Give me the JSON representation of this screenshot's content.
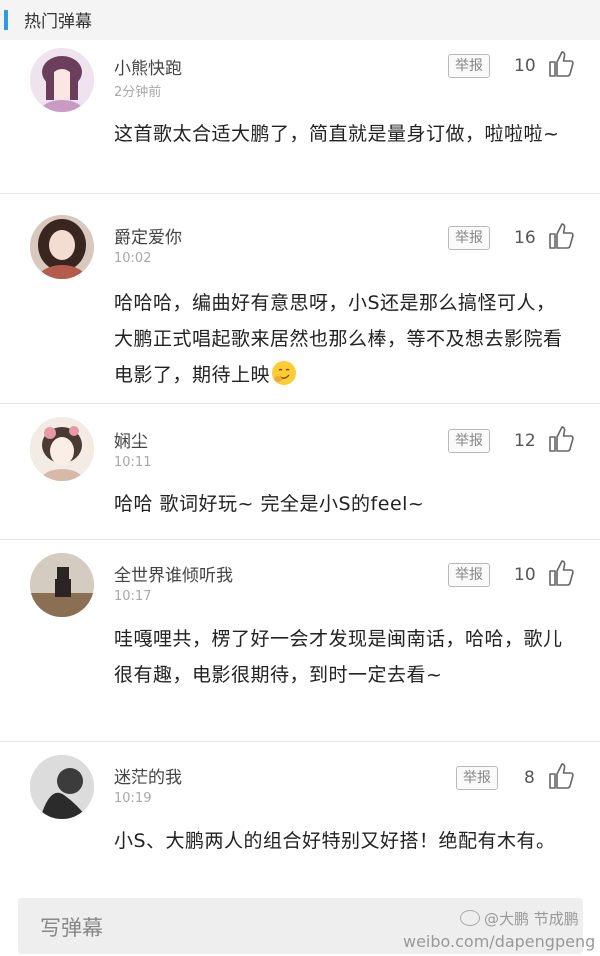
{
  "header": {
    "title": "热门弹幕"
  },
  "comments": [
    {
      "name": "小熊快跑",
      "time": "2分钟前",
      "report": "举报",
      "likes": "10",
      "text": "这首歌太合适大鹏了，简直就是量身订做，啦啦啦~"
    },
    {
      "name": "爵定爱你",
      "time": "10:02",
      "report": "举报",
      "likes": "16",
      "text": "哈哈哈，编曲好有意思呀，小S还是那么搞怪可人，大鹏正式唱起歌来居然也那么棒，等不及想去影院看电影了，期待上映",
      "emoji": "smirk-emoji"
    },
    {
      "name": "娴尘",
      "time": "10:11",
      "report": "举报",
      "likes": "12",
      "text": "哈哈 歌词好玩~ 完全是小S的feel~"
    },
    {
      "name": "全世界谁倾听我",
      "time": "10:17",
      "report": "举报",
      "likes": "10",
      "text": "哇嘎哩共，楞了好一会才发现是闽南话，哈哈，歌儿很有趣，电影很期待，到时一定去看~"
    },
    {
      "name": "迷茫的我",
      "time": "10:19",
      "report": "举报",
      "likes": "8",
      "text": "小S、大鹏两人的组合好特别又好搭！绝配有木有。"
    }
  ],
  "input": {
    "placeholder": "写弹幕"
  },
  "watermark": {
    "weibo_handle": "@大鹏 节成鹏",
    "url": "weibo.com/dapengpeng"
  },
  "colors": {
    "accent": "#2f9be0",
    "background": "#ffffff",
    "divider": "#e3e3e3"
  },
  "icons": {
    "like": "thumbs-up-icon",
    "weibo": "weibo-logo-icon"
  }
}
